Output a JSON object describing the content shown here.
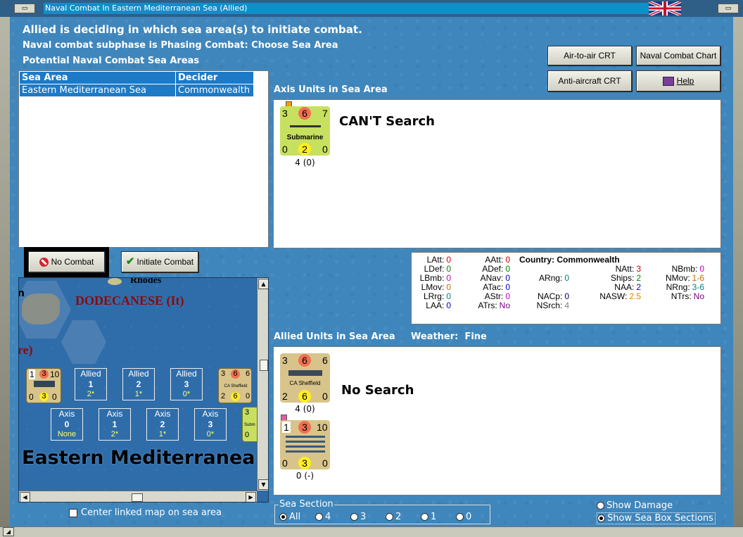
{
  "window": {
    "title": "Naval Combat In Eastern Mediterranean Sea (Allied)"
  },
  "header": {
    "line1": "Allied is deciding in which sea area(s) to initiate combat.",
    "line2": "Naval combat subphase is Phasing Combat: Choose Sea Area",
    "line3": "Potential Naval Combat Sea Areas"
  },
  "buttons": {
    "air_to_air": "Air-to-air CRT",
    "naval_chart": "Naval Combat Chart",
    "anti_aircraft": "Anti-aircraft CRT",
    "help": "Help",
    "no_combat": "No Combat",
    "initiate_combat": "Initiate Combat"
  },
  "sea_table": {
    "headers": [
      "Sea Area",
      "Decider"
    ],
    "rows": [
      {
        "area": "Eastern Mediterranean Sea",
        "decider": "Commonwealth"
      }
    ]
  },
  "axis_section": {
    "label": "Axis Units in Sea Area",
    "search_text": "CAN'T Search",
    "unit": {
      "top": [
        "3",
        "6",
        "7"
      ],
      "name": "Submarine",
      "bottom": [
        "0",
        "2",
        "0"
      ],
      "count": "4 (0)"
    }
  },
  "stats": {
    "country_label": "Country:",
    "country": "Commonwealth",
    "col1": [
      [
        "LAtt:",
        "0"
      ],
      [
        "LDef:",
        "0"
      ],
      [
        "LBmb:",
        "0"
      ],
      [
        "LMov:",
        "0"
      ],
      [
        "LRrg:",
        "0"
      ],
      [
        "LAA:",
        "0"
      ]
    ],
    "col2": [
      [
        "AAtt:",
        "0"
      ],
      [
        "ADef:",
        "0"
      ],
      [
        "ANav:",
        "0"
      ],
      [
        "ATac:",
        "0"
      ],
      [
        "AStr:",
        "0"
      ],
      [
        "ATrs:",
        "No"
      ]
    ],
    "col3": [
      [
        "ARng:",
        "0"
      ],
      [
        "NACp:",
        "0"
      ],
      [
        "NSrch:",
        "4"
      ]
    ],
    "col4": [
      [
        "NAtt:",
        "3"
      ],
      [
        "Ships:",
        "2"
      ],
      [
        "NAA:",
        "2"
      ],
      [
        "NASW:",
        "2.5"
      ]
    ],
    "col5": [
      [
        "NBmb:",
        "0"
      ],
      [
        "NMov:",
        "1-6"
      ],
      [
        "NRng:",
        "3-6"
      ],
      [
        "NTrs:",
        "No"
      ]
    ]
  },
  "allied_section": {
    "label": "Allied Units in Sea Area",
    "weather_label": "Weather:",
    "weather": "Fine",
    "search_text": "No Search",
    "units": [
      {
        "top": [
          "3",
          "6",
          "6"
        ],
        "name": "CA Sheffield",
        "bottom": [
          "2",
          "6",
          "0"
        ],
        "count": "4 (0)"
      },
      {
        "top": [
          "1",
          "3",
          "10"
        ],
        "name": "",
        "bottom": [
          "0",
          "3",
          "0"
        ],
        "count": "0 (-)"
      }
    ]
  },
  "map": {
    "labels": {
      "rhodes": "Rhodes",
      "dodecanese": "DODECANESE (It)",
      "partial_left": "n",
      "partial_re": "re)",
      "sea_name": "Eastern Mediterranean"
    },
    "allied_boxes": [
      {
        "side": "Allied",
        "num": "1",
        "val": "2*"
      },
      {
        "side": "Allied",
        "num": "2",
        "val": "1*"
      },
      {
        "side": "Allied",
        "num": "3",
        "val": "0*"
      }
    ],
    "axis_boxes": [
      {
        "side": "Axis",
        "num": "0",
        "val": "None"
      },
      {
        "side": "Axis",
        "num": "1",
        "val": "2*"
      },
      {
        "side": "Axis",
        "num": "2",
        "val": "1*"
      },
      {
        "side": "Axis",
        "num": "3",
        "val": "0*"
      }
    ],
    "counter_left": {
      "top": [
        "1",
        "3",
        "10"
      ],
      "bottom": [
        "0",
        "3",
        "0"
      ]
    },
    "counter_right": {
      "top": [
        "3",
        "6",
        "6"
      ],
      "name": "CA Sheffield",
      "bottom": [
        "2",
        "6",
        "0"
      ]
    },
    "counter_partial": {
      "top": "3",
      "name": "Subm",
      "bottom": "0"
    }
  },
  "center_linked": "Center linked map on sea area",
  "sea_section": {
    "label": "Sea Section",
    "options": [
      "All",
      "4",
      "3",
      "2",
      "1",
      "0"
    ],
    "selected": "All"
  },
  "options": {
    "show_damage": "Show Damage",
    "show_sea_box": "Show Sea Box Sections"
  },
  "colors": {
    "accent": "#1d7ac6",
    "background": "#3f86bc",
    "attack": "#f07050",
    "yellow": "#ffee22"
  }
}
